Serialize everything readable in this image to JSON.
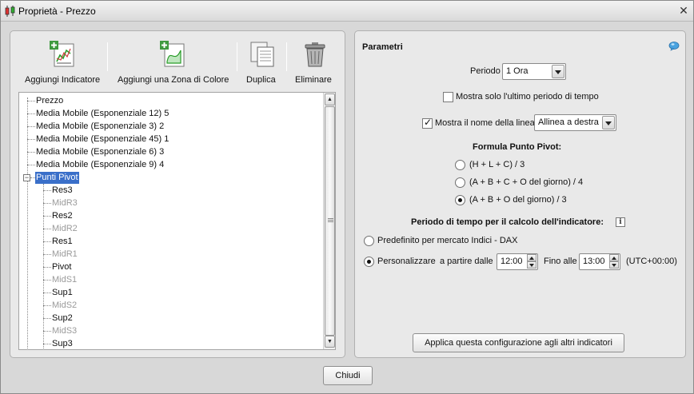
{
  "window": {
    "title": "Proprietà - Prezzo"
  },
  "toolbar": {
    "add_indicator": "Aggiungi Indicatore",
    "add_color_zone": "Aggiungi una Zona di Colore",
    "duplicate": "Duplica",
    "delete": "Eliminare"
  },
  "tree": {
    "root_items": [
      "Prezzo",
      "Media Mobile (Esponenziale 12) 5",
      "Media Mobile (Esponenziale 3) 2",
      "Media Mobile (Esponenziale 45) 1",
      "Media Mobile (Esponenziale 6) 3",
      "Media Mobile (Esponenziale 9) 4"
    ],
    "selected": "Punti Pivot",
    "children": [
      {
        "label": "Res3",
        "dim": false
      },
      {
        "label": "MidR3",
        "dim": true
      },
      {
        "label": "Res2",
        "dim": false
      },
      {
        "label": "MidR2",
        "dim": true
      },
      {
        "label": "Res1",
        "dim": false
      },
      {
        "label": "MidR1",
        "dim": true
      },
      {
        "label": "Pivot",
        "dim": false
      },
      {
        "label": "MidS1",
        "dim": true
      },
      {
        "label": "Sup1",
        "dim": false
      },
      {
        "label": "MidS2",
        "dim": true
      },
      {
        "label": "Sup2",
        "dim": false
      },
      {
        "label": "MidS3",
        "dim": true
      },
      {
        "label": "Sup3",
        "dim": false
      }
    ]
  },
  "params": {
    "title": "Parametri",
    "period_label": "Periodo",
    "period_value": "1 Ora",
    "only_last_period_label": "Mostra solo l'ultimo periodo di tempo",
    "only_last_period_checked": false,
    "show_line_name_label": "Mostra il nome della linea",
    "show_line_name_checked": true,
    "align_value": "Allinea a destra",
    "formula_title": "Formula Punto Pivot:",
    "formulas": [
      {
        "label": "(H + L + C) / 3",
        "selected": false
      },
      {
        "label": "(A + B + C + O del giorno) / 4",
        "selected": false
      },
      {
        "label": "(A + B + O del giorno) / 3",
        "selected": true
      }
    ],
    "calc_period_title": "Periodo di tempo per il calcolo dell'indicatore:",
    "default_market_label": "Predefinito per mercato Indici - DAX",
    "default_market_selected": false,
    "custom_label": "Personalizzare",
    "custom_selected": true,
    "from_label": "a partire dalle",
    "from_value": "12:00",
    "to_label": "Fino alle",
    "to_value": "13:00",
    "timezone": "(UTC+00:00)",
    "apply_button": "Applica questa configurazione agli altri indicatori"
  },
  "footer": {
    "close_button": "Chiudi"
  }
}
